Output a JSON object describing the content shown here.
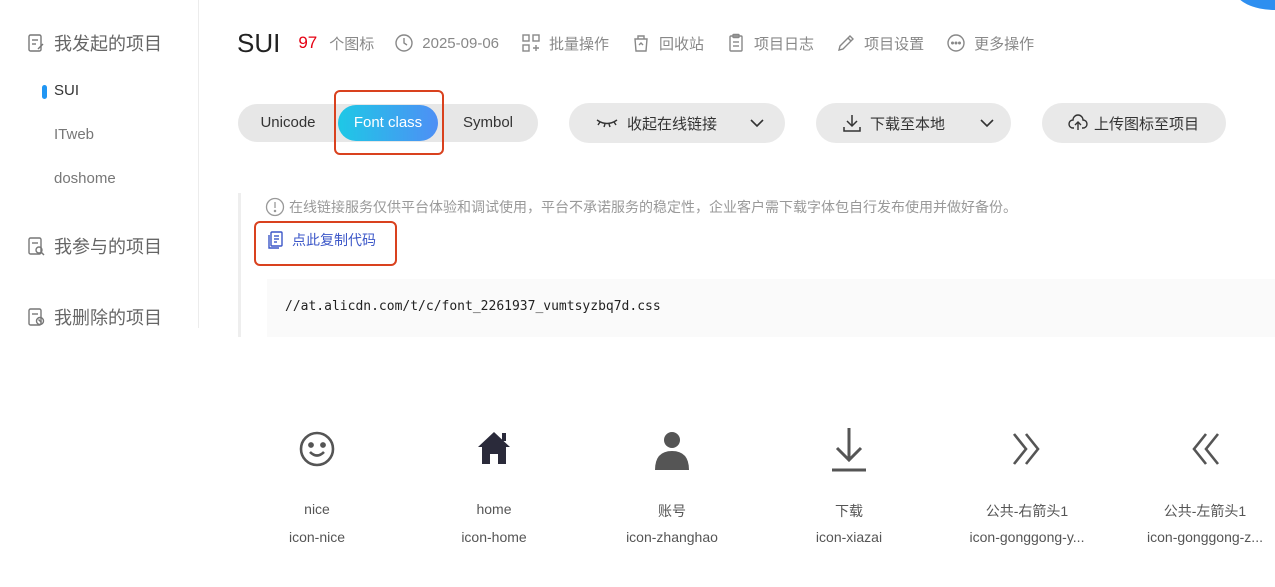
{
  "sidebar": {
    "groups": [
      {
        "label": "我发起的项目",
        "icon": "project-icon"
      },
      {
        "label": "我参与的项目",
        "icon": "participate-icon"
      },
      {
        "label": "我删除的项目",
        "icon": "deleted-icon"
      }
    ],
    "projects": [
      {
        "label": "SUI",
        "active": true
      },
      {
        "label": "ITweb",
        "active": false
      },
      {
        "label": "doshome",
        "active": false
      }
    ]
  },
  "header": {
    "title": "SUI",
    "icon_count": "97",
    "icon_count_unit": "个图标",
    "date": "2025-09-06",
    "actions": {
      "batch": "批量操作",
      "recycle": "回收站",
      "log": "项目日志",
      "settings": "项目设置",
      "more": "更多操作"
    }
  },
  "toolbar": {
    "modes": [
      "Unicode",
      "Font class",
      "Symbol"
    ],
    "active_mode": "Font class",
    "collapse_link": "收起在线链接",
    "download": "下载至本地",
    "upload": "上传图标至项目"
  },
  "notice": "在线链接服务仅供平台体验和调试使用，平台不承诺服务的稳定性，企业客户需下载字体包自行发布使用并做好备份。",
  "copy_code": "点此复制代码",
  "code_url": "//at.alicdn.com/t/c/font_2261937_vumtsyzbq7d.css",
  "icons": [
    {
      "name": "nice",
      "class": "icon-nice",
      "glyph": "smile-icon"
    },
    {
      "name": "home",
      "class": "icon-home",
      "glyph": "home-icon"
    },
    {
      "name": "账号",
      "class": "icon-zhanghao",
      "glyph": "user-icon"
    },
    {
      "name": "下载",
      "class": "icon-xiazai",
      "glyph": "download-icon"
    },
    {
      "name": "公共-右箭头1",
      "class": "icon-gonggong-y...",
      "glyph": "double-right-arrow-icon"
    },
    {
      "name": "公共-左箭头1",
      "class": "icon-gonggong-z...",
      "glyph": "double-left-arrow-icon"
    }
  ],
  "colors": {
    "accent_gradient_start": "#1ec8e6",
    "accent_gradient_end": "#4e8ff5",
    "count_red": "#e60012",
    "link_blue": "#3c57c8",
    "highlight_box": "#d9411e",
    "active_marker": "#2196f3"
  }
}
